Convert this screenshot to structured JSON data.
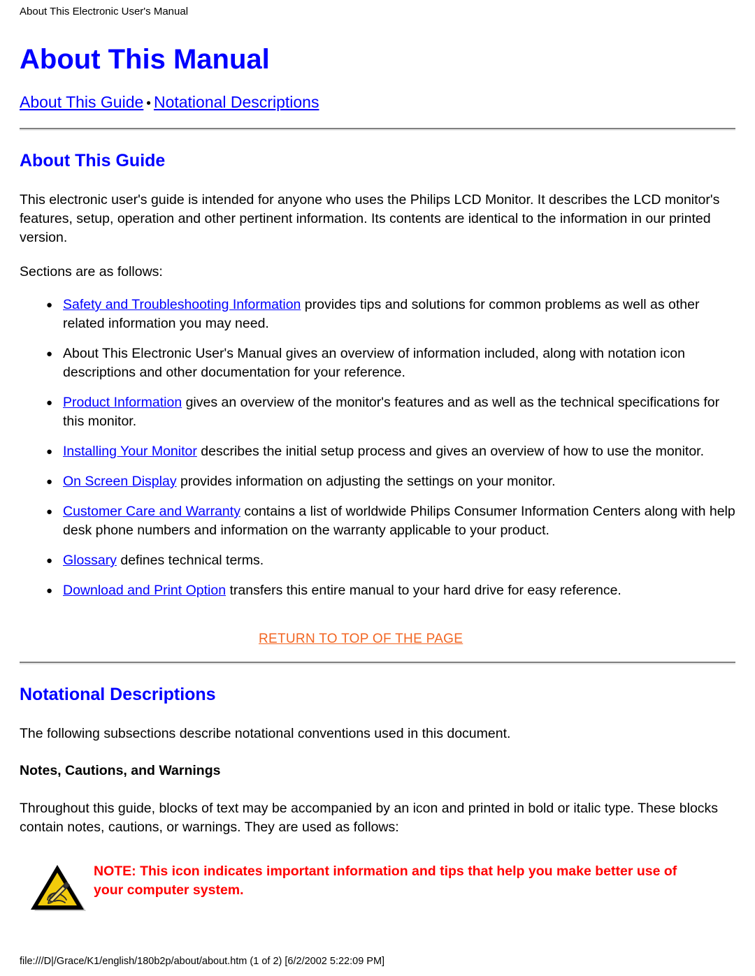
{
  "running_header": "About This Electronic User's Manual",
  "document": {
    "title": "About This Manual"
  },
  "nav": {
    "separator": "•",
    "links": [
      {
        "label": "About This Guide"
      },
      {
        "label": "Notational Descriptions"
      }
    ]
  },
  "about_guide": {
    "heading": "About This Guide",
    "intro": "This electronic user's guide is intended for anyone who uses the Philips LCD Monitor. It describes the LCD monitor's features, setup, operation and other pertinent information. Its contents are identical to the information in our printed version.",
    "sections_lead": "Sections are as follows:",
    "items": [
      {
        "link": "Safety and Troubleshooting Information",
        "text": " provides tips and solutions for common problems as well as other related information you may need."
      },
      {
        "link": "",
        "text": "About This Electronic User's Manual gives an overview of information included, along with notation icon descriptions and other documentation for your reference."
      },
      {
        "link": "Product Information",
        "text": " gives an overview of the monitor's features and as well as the technical specifications for this monitor."
      },
      {
        "link": "Installing Your Monitor",
        "text": " describes the initial setup process and gives an overview of how to use the monitor."
      },
      {
        "link": "On Screen Display",
        "text": " provides information on adjusting the settings on your monitor."
      },
      {
        "link": "Customer Care and Warranty",
        "text": " contains a list of worldwide Philips Consumer Information Centers along with help desk phone numbers and information on the warranty applicable to your product."
      },
      {
        "link": "Glossary",
        "text": " defines technical terms."
      },
      {
        "link": "Download and Print Option",
        "text": " transfers this entire manual to your hard drive for easy reference."
      }
    ],
    "return_to_top": "RETURN TO TOP OF THE PAGE"
  },
  "notational": {
    "heading": "Notational Descriptions",
    "intro": "The following subsections describe notational conventions used in this document.",
    "sub_heading": "Notes, Cautions, and Warnings",
    "body": "Throughout this guide, blocks of text may be accompanied by an icon and printed in bold or italic type. These blocks contain notes, cautions, or warnings. They are used as follows:",
    "note": {
      "icon_name": "note-warning-triangle-icon",
      "text": "NOTE: This icon indicates important information and tips that help you make better use of your computer system."
    }
  },
  "footer": {
    "path": "file:///D|/Grace/K1/english/180b2p/about/about.htm (1 of 2) [6/2/2002 5:22:09 PM]"
  },
  "colors": {
    "heading_blue": "#0000FF",
    "link_blue": "#0000FF",
    "return_orange": "#F26522",
    "note_red": "#FF0000",
    "icon_yellow": "#F2CB0B",
    "text_black": "#000000"
  }
}
